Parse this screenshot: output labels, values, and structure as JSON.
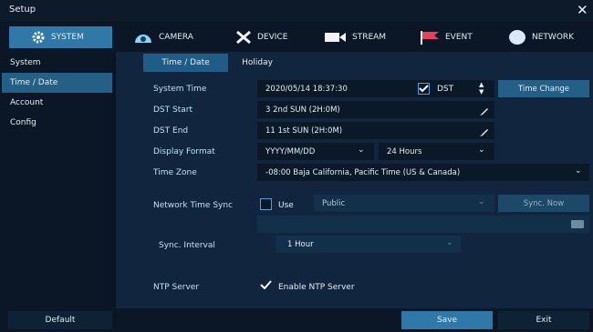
{
  "window": {
    "title": "Setup"
  },
  "tabs": [
    {
      "label": "SYSTEM",
      "icon": "gear-icon"
    },
    {
      "label": "CAMERA",
      "icon": "camera-icon"
    },
    {
      "label": "DEVICE",
      "icon": "tools-icon"
    },
    {
      "label": "STREAM",
      "icon": "video-icon"
    },
    {
      "label": "EVENT",
      "icon": "flag-icon"
    },
    {
      "label": "NETWORK",
      "icon": "globe-icon"
    }
  ],
  "sidebar": {
    "items": [
      {
        "label": "System"
      },
      {
        "label": "Time / Date"
      },
      {
        "label": "Account"
      },
      {
        "label": "Config"
      }
    ]
  },
  "subtabs": [
    {
      "label": "Time / Date"
    },
    {
      "label": "Holiday"
    }
  ],
  "form": {
    "system_time": {
      "label": "System Time",
      "value": "2020/05/14 18:37:30",
      "dst_label": "DST",
      "dst_checked": true,
      "button": "Time Change"
    },
    "dst_start": {
      "label": "DST Start",
      "value": "3 2nd SUN (2H:0M)"
    },
    "dst_end": {
      "label": "DST End",
      "value": "11 1st SUN (2H:0M)"
    },
    "display_format": {
      "label": "Display Format",
      "date_value": "YYYY/MM/DD",
      "time_value": "24 Hours"
    },
    "time_zone": {
      "label": "Time Zone",
      "value": "-08:00 Baja California, Pacific Time (US & Canada)"
    },
    "network_time_sync": {
      "label": "Network Time Sync",
      "use_label": "Use",
      "use_checked": false,
      "server_value": "Public",
      "button": "Sync. Now",
      "server_address": ""
    },
    "sync_interval": {
      "label": "Sync. Interval",
      "value": "1 Hour"
    },
    "ntp_server": {
      "label": "NTP Server",
      "checkbox_label": "Enable NTP Server",
      "checked": true
    }
  },
  "footer": {
    "default_label": "Default",
    "save_label": "Save",
    "exit_label": "Exit"
  },
  "colors": {
    "accent": "#2f78a8",
    "panel": "#11263e",
    "field": "#0b1828"
  }
}
